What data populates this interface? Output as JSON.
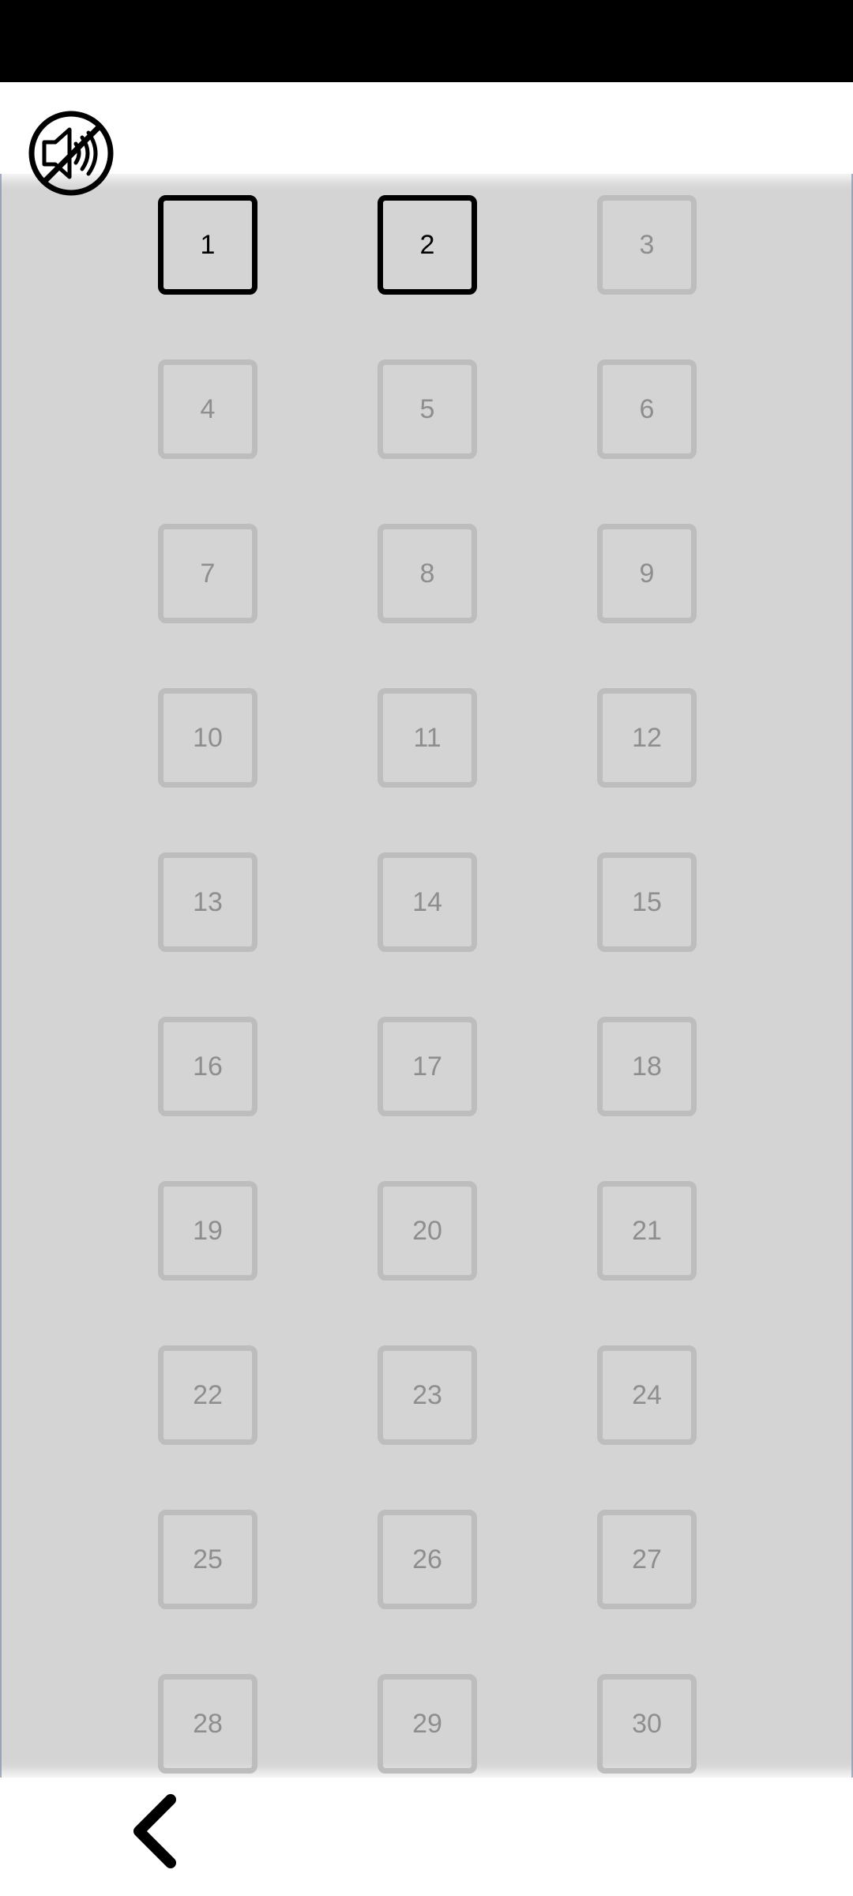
{
  "header": {
    "sound_icon": "speaker-muted-icon"
  },
  "levels": {
    "items": [
      {
        "label": "1",
        "state": "unlocked"
      },
      {
        "label": "2",
        "state": "unlocked"
      },
      {
        "label": "3",
        "state": "locked"
      },
      {
        "label": "4",
        "state": "locked"
      },
      {
        "label": "5",
        "state": "locked"
      },
      {
        "label": "6",
        "state": "locked"
      },
      {
        "label": "7",
        "state": "locked"
      },
      {
        "label": "8",
        "state": "locked"
      },
      {
        "label": "9",
        "state": "locked"
      },
      {
        "label": "10",
        "state": "locked"
      },
      {
        "label": "11",
        "state": "locked"
      },
      {
        "label": "12",
        "state": "locked"
      },
      {
        "label": "13",
        "state": "locked"
      },
      {
        "label": "14",
        "state": "locked"
      },
      {
        "label": "15",
        "state": "locked"
      },
      {
        "label": "16",
        "state": "locked"
      },
      {
        "label": "17",
        "state": "locked"
      },
      {
        "label": "18",
        "state": "locked"
      },
      {
        "label": "19",
        "state": "locked"
      },
      {
        "label": "20",
        "state": "locked"
      },
      {
        "label": "21",
        "state": "locked"
      },
      {
        "label": "22",
        "state": "locked"
      },
      {
        "label": "23",
        "state": "locked"
      },
      {
        "label": "24",
        "state": "locked"
      },
      {
        "label": "25",
        "state": "locked"
      },
      {
        "label": "26",
        "state": "locked"
      },
      {
        "label": "27",
        "state": "locked"
      },
      {
        "label": "28",
        "state": "locked"
      },
      {
        "label": "29",
        "state": "locked"
      },
      {
        "label": "30",
        "state": "locked"
      }
    ]
  },
  "footer": {
    "back_icon": "chevron-left-icon"
  },
  "colors": {
    "status_bar": "#000000",
    "panel_bg": "#d4d4d4",
    "locked_border": "#bdbdbd",
    "locked_text": "#8e8e8e",
    "unlocked_border": "#000000"
  }
}
